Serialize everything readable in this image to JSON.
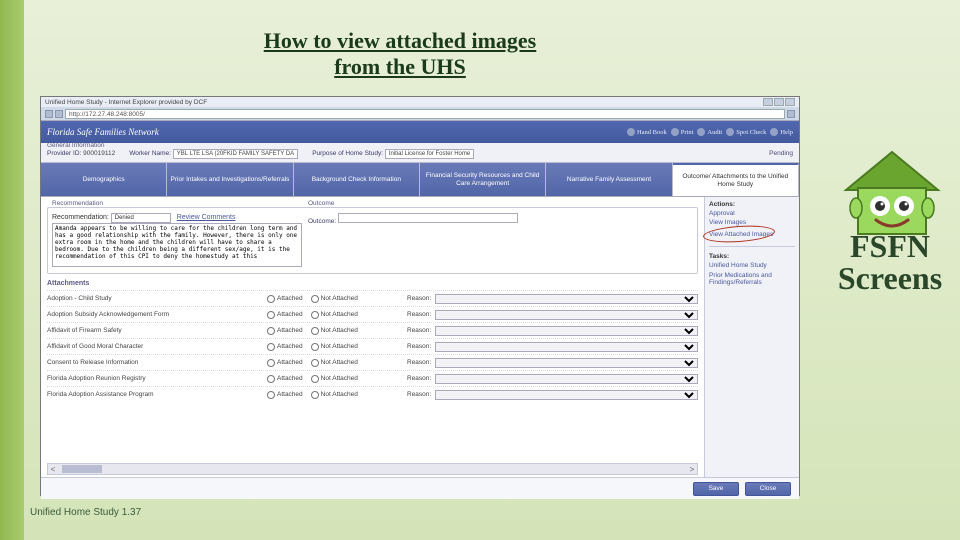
{
  "slide": {
    "title_line1": "How to view attached images",
    "title_line2": "from the UHS",
    "side_label": "FSFN Screens",
    "footer": "Unified Home Study 1.37"
  },
  "browser": {
    "url": "http://172.27.48.248:8005/",
    "window_title": "Unified Home Study - Internet Explorer provided by DCF"
  },
  "app": {
    "brand": "Florida Safe Families Network",
    "topmenu": [
      "Hand Book",
      "Print",
      "Audit",
      "Spot Check",
      "Help"
    ]
  },
  "general_info": {
    "section_label": "General Information",
    "provider_label": "Provider ID:",
    "provider_id": "900019112",
    "worker_label": "Worker Name:",
    "worker_name": "YBL LTE   LSA   (20FKID FAMILY SAFETY DA",
    "purpose_label": "Purpose of Home Study:",
    "purpose_value": "Initial License for Foster Home",
    "status": "Pending"
  },
  "tabs": [
    "Demographics",
    "Prior Intakes and Investigations/Referrals",
    "Background Check Information",
    "Financial Security Resources and Child Care Arrangement",
    "Narrative Family Assessment",
    "Outcome/ Attachments to the Unified Home Study"
  ],
  "recommendation": {
    "section_title": "Recommendation",
    "rec_label": "Recommendation:",
    "rec_value": "Denied",
    "review_link": "Review Comments",
    "textarea": "Amanda appears to be willing to care for the children long term and has a good relationship with the family. However, there is only one extra room in the home and the children will have to share a bedroom. Due to the children being a different sex/age, it is the recommendation of this CPI to deny the homestudy at this",
    "outcome_section": "Outcome",
    "outcome_label": "Outcome:",
    "outcome_value": ""
  },
  "attachments": {
    "heading": "Attachments",
    "col_attached": "Attached",
    "col_not_attached": "Not Attached",
    "col_reason": "Reason:",
    "rows": [
      "Adoption - Child Study",
      "Adoption Subsidy Acknowledgement Form",
      "Affidavit of Firearm Safety",
      "Affidavit of Good Moral Character",
      "Consent to Release Information",
      "Florida Adoption Reunion Registry",
      "Florida Adoption Assistance Program"
    ]
  },
  "sidebar": {
    "actions_hdr": "Actions:",
    "links": [
      "Approval",
      "View Images",
      "View Attached Images"
    ],
    "tasks_hdr": "Tasks:",
    "task_links": [
      "Unified Home Study",
      "Prior Medications and Findings/Referrals"
    ]
  },
  "buttons": {
    "save": "Save",
    "close": "Close"
  }
}
